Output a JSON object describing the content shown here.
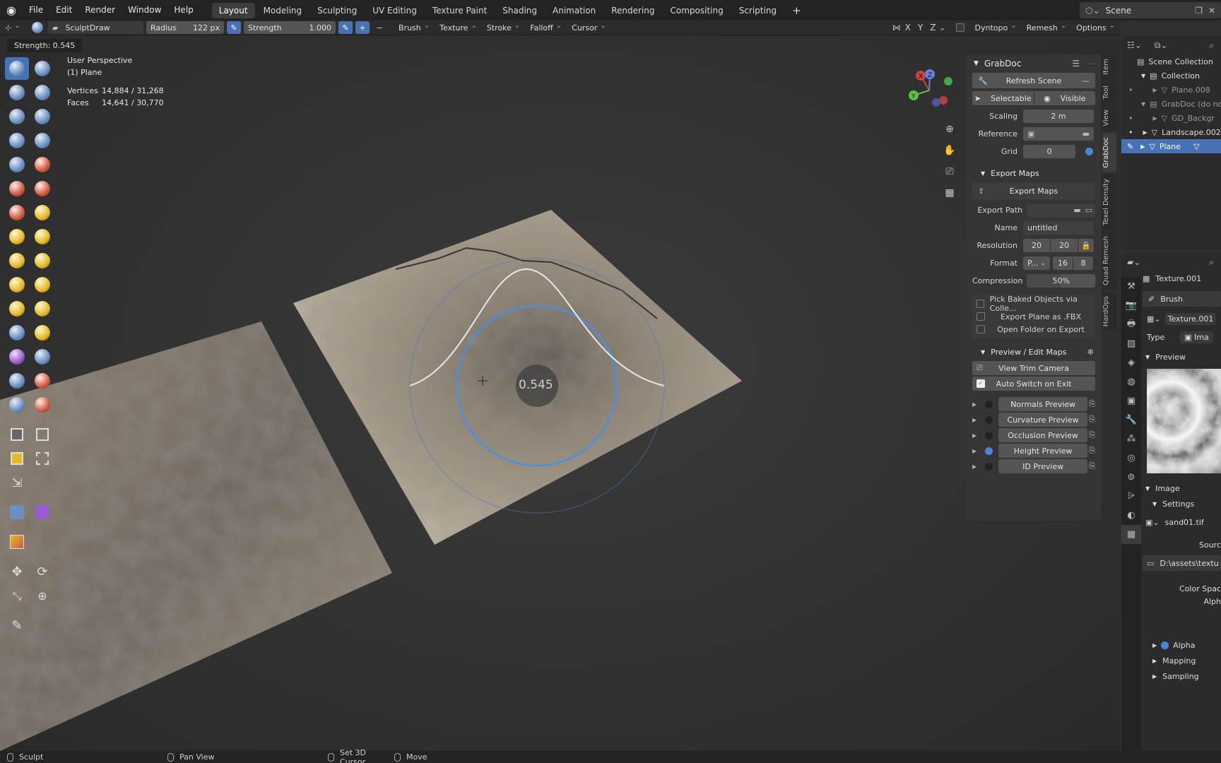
{
  "menu": {
    "items": [
      "File",
      "Edit",
      "Render",
      "Window",
      "Help"
    ]
  },
  "workspaces": {
    "tabs": [
      "Layout",
      "Modeling",
      "Sculpting",
      "UV Editing",
      "Texture Paint",
      "Shading",
      "Animation",
      "Rendering",
      "Compositing",
      "Scripting"
    ],
    "active": "Layout",
    "add": "+"
  },
  "scene": {
    "name": "Scene"
  },
  "toolheader": {
    "brush_name": "SculptDraw",
    "radius_label": "Radius",
    "radius_value": "122 px",
    "strength_label": "Strength",
    "strength_value": "1.000",
    "plus": "+",
    "minus": "−",
    "dropdowns": [
      "Brush",
      "Texture",
      "Stroke",
      "Falloff",
      "Cursor"
    ],
    "axes": [
      "X",
      "Y",
      "Z"
    ],
    "right": [
      "Dyntopo",
      "Remesh",
      "Options"
    ]
  },
  "viewport": {
    "tip": "Strength: 0.545",
    "perspective": "User Perspective",
    "object": "(1) Plane",
    "vertices_label": "Vertices",
    "vertices_value": "14,884 / 31,268",
    "faces_label": "Faces",
    "faces_value": "14,641 / 30,770",
    "strength_overlay": "0.545",
    "gizmo": {
      "x": "X",
      "y": "Y",
      "z": "Z"
    }
  },
  "grabdoc": {
    "title": "GrabDoc",
    "refresh": "Refresh Scene",
    "selectable": "Selectable",
    "visible": "Visible",
    "scaling_label": "Scaling",
    "scaling_value": "2 m",
    "reference_label": "Reference",
    "grid_label": "Grid",
    "grid_value": "0",
    "export_section": "Export Maps",
    "export_button": "Export Maps",
    "export_path_label": "Export Path",
    "name_label": "Name",
    "name_value": "untitled",
    "resolution_label": "Resolution",
    "res_x": "20",
    "res_y": "20",
    "format_label": "Format",
    "format_value": "P...",
    "bit16": "16",
    "bit8": "8",
    "compression_label": "Compression",
    "compression_value": "50%",
    "options": [
      "Pick Baked Objects via Colle...",
      "Export Plane as .FBX",
      "Open Folder on Export"
    ],
    "preview_section": "Preview / Edit Maps",
    "view_trim": "View Trim Camera",
    "auto_switch": "Auto Switch on Exit",
    "maps": [
      {
        "label": "Normals Preview",
        "on": false
      },
      {
        "label": "Curvature Preview",
        "on": false
      },
      {
        "label": "Occlusion Preview",
        "on": false
      },
      {
        "label": "Height Preview",
        "on": true
      },
      {
        "label": "ID Preview",
        "on": false
      }
    ]
  },
  "vtabs": [
    "Item",
    "Tool",
    "View",
    "GrabDoc",
    "Texel Density",
    "Quad Remesh",
    "HardOps"
  ],
  "vtabs_active": "GrabDoc",
  "outliner": {
    "items": [
      {
        "label": "Scene Collection",
        "indent": 0
      },
      {
        "label": "Collection",
        "indent": 1
      },
      {
        "label": "Plane.008",
        "indent": 2
      },
      {
        "label": "GrabDoc (do no",
        "indent": 1
      },
      {
        "label": "GD_Backgr",
        "indent": 2
      },
      {
        "label": "Landscape.002",
        "indent": 1
      },
      {
        "label": "Plane",
        "indent": 1,
        "selected": true
      }
    ]
  },
  "properties": {
    "texture_name": "Texture.001",
    "brush_label": "Brush",
    "texture_slot": "Texture.001",
    "type_label": "Type",
    "type_value": "Ima",
    "preview_section": "Preview",
    "image_section": "Image",
    "settings_section": "Settings",
    "image_file": "sand01.tif",
    "source_label": "Sourc",
    "path_value": "D:\\assets\\textu",
    "colorspace_label": "Color Spac",
    "alpha_label": "Alph",
    "sub_alpha": "Alpha",
    "mapping": "Mapping",
    "sampling": "Sampling"
  },
  "statusbar": {
    "items": [
      "Sculpt",
      "Pan View",
      "Set 3D Cursor",
      "Move"
    ]
  }
}
